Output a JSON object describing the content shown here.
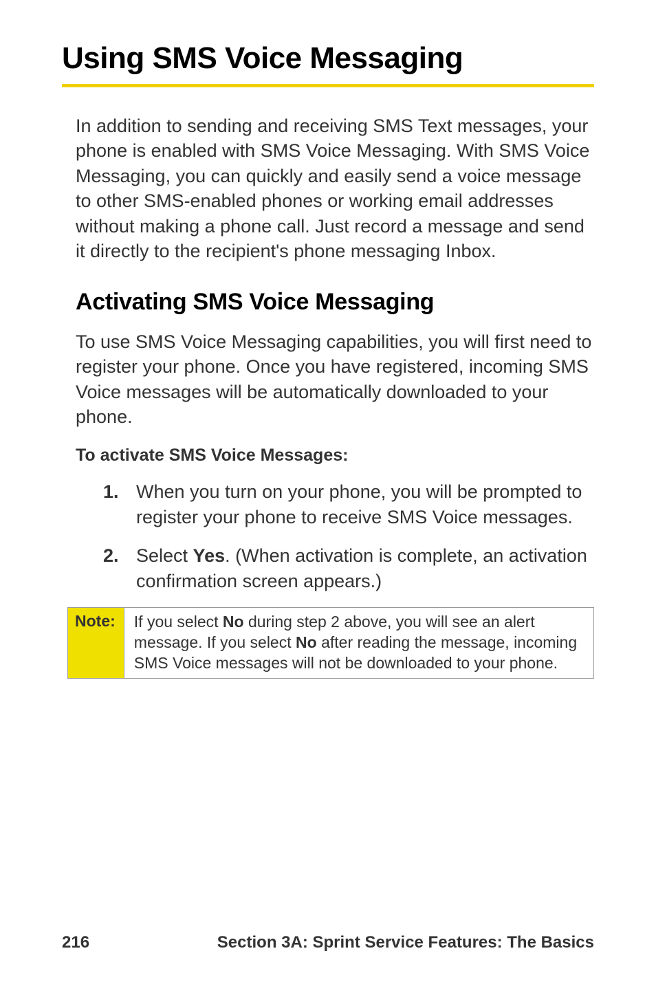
{
  "heading": "Using SMS Voice Messaging",
  "intro": "In addition to sending and receiving SMS Text messages, your phone is enabled with SMS Voice Messaging. With SMS Voice Messaging, you can quickly and easily send a voice message to other SMS-enabled phones or working email addresses without making a phone call. Just record a message and send it directly to the recipient's phone messaging Inbox.",
  "subheading": "Activating SMS Voice Messaging",
  "body1": "To use SMS Voice Messaging capabilities, you will first need to register your phone. Once you have registered, incoming SMS Voice messages will be automatically downloaded to your phone.",
  "subsubheading": "To activate SMS Voice Messages:",
  "list": {
    "item1_num": "1.",
    "item1_text": "When you turn on your phone, you will be prompted to register your phone to receive SMS Voice messages.",
    "item2_num": "2.",
    "item2_before": "Select ",
    "item2_bold": "Yes",
    "item2_after": ". (When activation is complete, an activation confirmation screen appears.)"
  },
  "note": {
    "label": "Note:",
    "part1": "If you select ",
    "bold1": "No",
    "part2": " during step 2 above, you will see an alert message. If you select ",
    "bold2": "No",
    "part3": " after reading the message, incoming SMS Voice messages will not be downloaded to your phone."
  },
  "footer": {
    "page": "216",
    "section": "Section 3A: Sprint Service Features: The Basics"
  }
}
